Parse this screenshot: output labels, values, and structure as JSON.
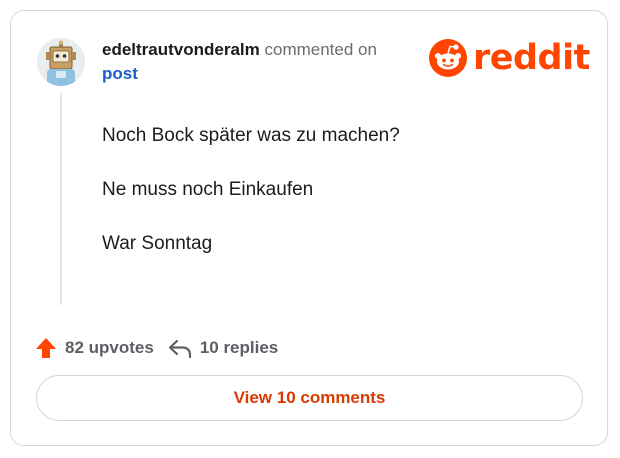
{
  "comment": {
    "username": "edeltrautvonderalm",
    "action_text": "commented on",
    "post_link": "post",
    "avatar_icon": "robot-avatar-icon",
    "paragraphs": [
      "Noch Bock später was zu machen?",
      "Ne muss noch Einkaufen",
      "War Sonntag"
    ]
  },
  "brand": {
    "logo_text": "reddit",
    "logo_icon": "reddit-snoo-icon",
    "color": "#ff4500"
  },
  "stats": {
    "upvotes_label": "82 upvotes",
    "replies_label": "10 replies",
    "upvote_icon": "upvote-arrow-icon",
    "reply_icon": "reply-arrow-icon",
    "upvote_color": "#ff4500"
  },
  "actions": {
    "view_comments_label": "View 10 comments",
    "button_text_color": "#d93a00"
  }
}
